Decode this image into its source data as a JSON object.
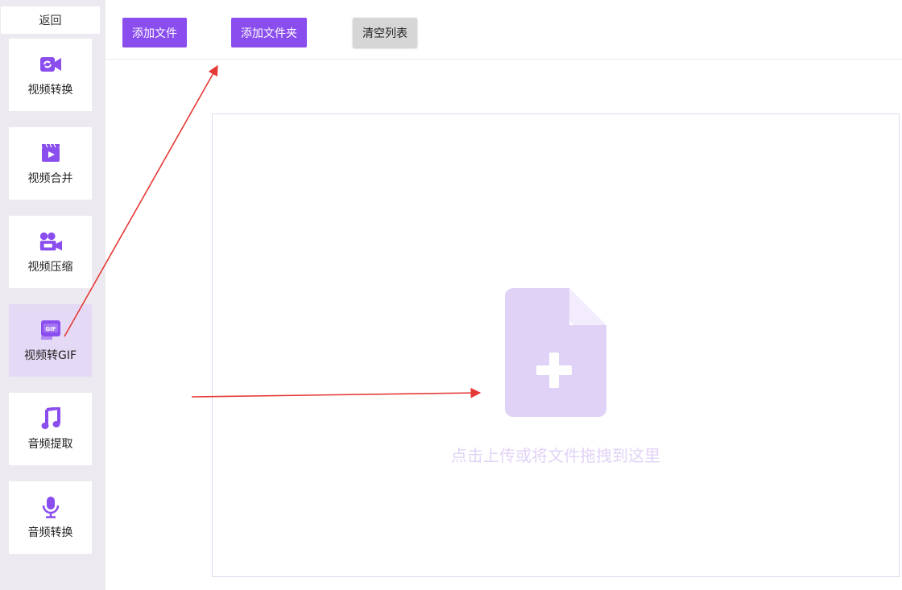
{
  "sidebar": {
    "back_label": "返回",
    "items": [
      {
        "label": "视频转换",
        "icon": "video-convert-icon"
      },
      {
        "label": "视频合并",
        "icon": "video-merge-icon"
      },
      {
        "label": "视频压缩",
        "icon": "video-compress-icon"
      },
      {
        "label": "视频转GIF",
        "icon": "gif-icon",
        "active": true
      },
      {
        "label": "音频提取",
        "icon": "music-note-icon"
      },
      {
        "label": "音频转换",
        "icon": "microphone-icon"
      }
    ]
  },
  "toolbar": {
    "add_file_label": "添加文件",
    "add_folder_label": "添加文件夹",
    "clear_list_label": "清空列表"
  },
  "drop_zone": {
    "hint": "点击上传或将文件拖拽到这里",
    "icon": "file-plus-icon"
  },
  "colors": {
    "accent": "#8a4dee",
    "sidebar_bg": "#eceaf0",
    "active_item_bg": "#e5daf6",
    "upload_icon": "#e0d1f6",
    "annotation_arrow": "#e53935"
  }
}
